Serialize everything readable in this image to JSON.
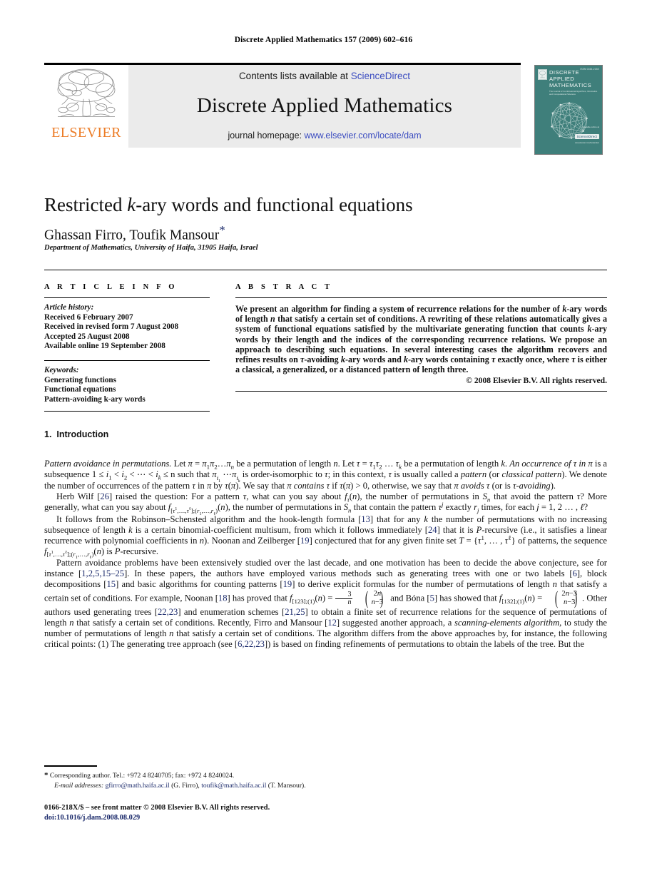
{
  "running_head": "Discrete Applied Mathematics 157 (2009) 602–616",
  "banner": {
    "publisher_name": "ELSEVIER",
    "contents_prefix": "Contents lists available at ",
    "contents_link": "ScienceDirect",
    "journal_title": "Discrete Applied Mathematics",
    "homepage_prefix": "journal homepage: ",
    "homepage_link": "www.elsevier.com/locate/dam"
  },
  "cover": {
    "issn": "ISSN 0166-218X",
    "line1": "DISCRETE",
    "line2": "APPLIED",
    "line3": "MATHEMATICS",
    "subtitle": "The Journal of Combinatorial Algorithms, Informatics and Computational Sciences",
    "publisher_note": "Available online at",
    "sciencedirect_badge": "ScienceDirect",
    "footer_note": "www.elsevier.com/locate/dam"
  },
  "article": {
    "title_part1": "Restricted ",
    "title_k": "k",
    "title_part2": "-ary words and functional equations",
    "authors": "Ghassan Firro, Toufik Mansour",
    "corresponding_marker": "*",
    "affiliation": "Department of Mathematics, University of Haifa, 31905 Haifa, Israel"
  },
  "article_info": {
    "heading": "A R T I C L E   I N F O",
    "history_label": "Article history:",
    "history": [
      "Received 6 February 2007",
      "Received in revised form 7 August 2008",
      "Accepted 25 August 2008",
      "Available online 19 September 2008"
    ],
    "keywords_label": "Keywords:",
    "keywords": [
      "Generating functions",
      "Functional equations",
      "Pattern-avoiding k-ary words"
    ]
  },
  "abstract": {
    "heading": "A B S T R A C T",
    "text_segments": [
      "We present an algorithm for finding a system of recurrence relations for the number of ",
      "k",
      "-ary words of length ",
      "n",
      " that satisfy a certain set of conditions. A rewriting of these relations automatically gives a system of functional equations satisfied by the multivariate generating function that counts ",
      "k",
      "-ary words by their length and the indices of the corresponding recurrence relations. We propose an approach to describing such equations. In several interesting cases the algorithm recovers and refines results on ",
      "τ",
      "-avoiding ",
      "k",
      "-ary words and ",
      "k",
      "-ary words containing ",
      "τ",
      " exactly once, where ",
      "τ",
      " is either a classical, a generalized, or a distanced pattern of length three."
    ],
    "copyright": "© 2008 Elsevier B.V. All rights reserved."
  },
  "introduction": {
    "section_number": "1.",
    "section_title": "Introduction",
    "paragraph1_lead": "Pattern avoidance in permutations.",
    "paragraph1": "Let π = π₁π₂…πₙ be a permutation of length n. Let τ = τ₁τ₂…τ_k be a permutation of length k. An occurrence of τ in π is a subsequence 1 ≤ i₁ < i₂ < ⋯ < i_k ≤ n such that π_{i₁}⋯π_{i_k} is order-isomorphic to τ; in this context, τ is usually called a pattern (or classical pattern). We denote the number of occurrences of the pattern τ in π by τ(π). We say that π contains τ if τ(π) > 0, otherwise, we say that π avoids τ (or is τ-avoiding).",
    "paragraph2": "Herb Wilf [26] raised the question: For a pattern τ, what can you say about f_τ(n), the number of permutations in Sₙ that avoid the pattern τ? More generally, what can you say about f_{[τ¹,…,τ^ℓ];(r₁,…,r_ℓ)}(n), the number of permutations in Sₙ that contain the pattern τ^j exactly r_j times, for each j = 1, 2 …, ℓ?",
    "paragraph3": "It follows from the Robinson–Schensted algorithm and the hook-length formula [13] that for any k the number of permutations with no increasing subsequence of length k is a certain binomial-coefficient multisum, from which it follows immediately [24] that it is P-recursive (i.e., it satisfies a linear recurrence with polynomial coefficients in n). Noonan and Zeilberger [19] conjectured that for any given finite set T = {τ¹, … , τ^ℓ} of patterns, the sequence f_{[τ¹,…,τ^ℓ];(r₁,…,r_ℓ)}(n) is P-recursive.",
    "paragraph4": "Pattern avoidance problems have been extensively studied over the last decade, and one motivation has been to decide the above conjecture, see for instance [1,2,5,15–25]. In these papers, the authors have employed various methods such as generating trees with one or two labels [6], block decompositions [15] and basic algorithms for counting patterns [19] to derive explicit formulas for the number of permutations of length n that satisfy a certain set of conditions. For example, Noonan [18] has proved that f_{[123];(1)}(n) = (3/n)(2n choose n−3) and Bóna [5] has showed that f_{[132];(1)}(n) = (2n−3 choose n−3). Other authors used generating trees [22,23] and enumeration schemes [21,25] to obtain a finite set of recurrence relations for the sequence of permutations of length n that satisfy a certain set of conditions. Recently, Firro and Mansour [12] suggested another approach, a scanning-elements algorithm, to study the number of permutations of length n that satisfy a certain set of conditions. The algorithm differs from the above approaches by, for instance, the following critical points: (1) The generating tree approach (see [6,22,23]) is based on finding refinements of permutations to obtain the labels of the tree. But the",
    "citations": [
      "26",
      "13",
      "24",
      "19",
      "1,2,5,15–25",
      "6",
      "15",
      "19",
      "18",
      "5",
      "22,23",
      "21,25",
      "12",
      "6,22,23"
    ]
  },
  "footnote": {
    "marker": "*",
    "corresponding": "Corresponding author. Tel.: +972 4 8240705; fax: +972 4 8240024.",
    "email_label": "E-mail addresses:",
    "email1": "gfirro@math.haifa.ac.il",
    "email1_who": "(G. Firro),",
    "email2": "toufik@math.haifa.ac.il",
    "email2_who": "(T. Mansour)."
  },
  "frontmatter": {
    "line1": "0166-218X/$ – see front matter © 2008 Elsevier B.V. All rights reserved.",
    "doi": "doi:10.1016/j.dam.2008.08.029"
  },
  "colors": {
    "link": "#3b4cc0",
    "citation": "#1b2a6b",
    "elsevier_orange": "#ec7c26",
    "cover_teal": "#3f7f7b",
    "banner_grey": "#ebebeb"
  }
}
